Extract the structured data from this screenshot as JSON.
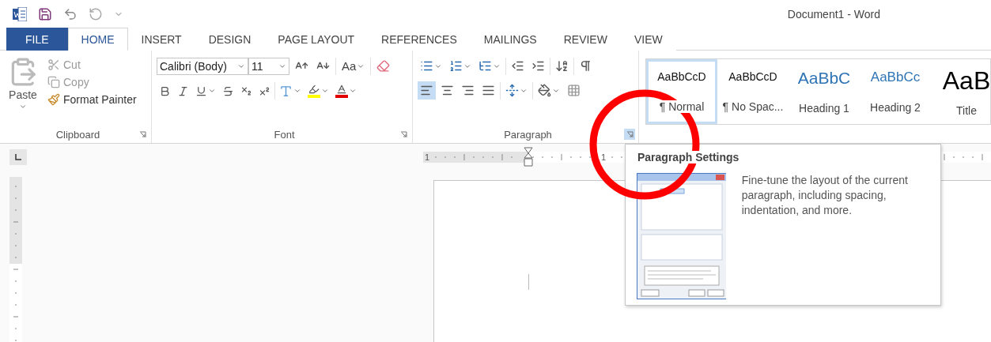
{
  "window": {
    "title": "Document1 - Word"
  },
  "tabs": [
    {
      "label": "FILE",
      "kind": "file",
      "selected": false
    },
    {
      "label": "HOME",
      "kind": "tab",
      "selected": true
    },
    {
      "label": "INSERT",
      "kind": "tab",
      "selected": false
    },
    {
      "label": "DESIGN",
      "kind": "tab",
      "selected": false
    },
    {
      "label": "PAGE LAYOUT",
      "kind": "tab",
      "selected": false
    },
    {
      "label": "REFERENCES",
      "kind": "tab",
      "selected": false
    },
    {
      "label": "MAILINGS",
      "kind": "tab",
      "selected": false
    },
    {
      "label": "REVIEW",
      "kind": "tab",
      "selected": false
    },
    {
      "label": "VIEW",
      "kind": "tab",
      "selected": false
    }
  ],
  "clipboard": {
    "label": "Clipboard",
    "paste": {
      "label": "Paste",
      "disabled": true
    },
    "cut": {
      "label": "Cut",
      "disabled": true
    },
    "copy": {
      "label": "Copy",
      "disabled": true
    },
    "format_painter": {
      "label": "Format Painter",
      "disabled": false
    }
  },
  "font": {
    "label": "Font",
    "name": "Calibri (Body)",
    "size": "11",
    "change_case": "Aa"
  },
  "paragraph": {
    "label": "Paragraph",
    "launcher_hovered": true,
    "alignments": [
      {
        "kind": "left",
        "selected": true
      },
      {
        "kind": "center",
        "selected": false
      },
      {
        "kind": "right",
        "selected": false
      },
      {
        "kind": "justify",
        "selected": false
      }
    ]
  },
  "styles": [
    {
      "preview": "AaBbCcD",
      "name": "¶ Normal",
      "kind": "body",
      "selected": true
    },
    {
      "preview": "AaBbCcD",
      "name": "¶ No Spac...",
      "kind": "body",
      "selected": false
    },
    {
      "preview": "AaBbC",
      "name": "Heading 1",
      "kind": "heading1",
      "selected": false
    },
    {
      "preview": "AaBbCc",
      "name": "Heading 2",
      "kind": "heading2",
      "selected": false
    },
    {
      "preview": "AaB",
      "name": "Title",
      "kind": "title",
      "selected": false
    }
  ],
  "ruler": {
    "labels": [
      "1",
      "1"
    ]
  },
  "tooltip": {
    "title": "Paragraph Settings",
    "description": "Fine-tune the layout of the current paragraph, including spacing, indentation, and more."
  }
}
